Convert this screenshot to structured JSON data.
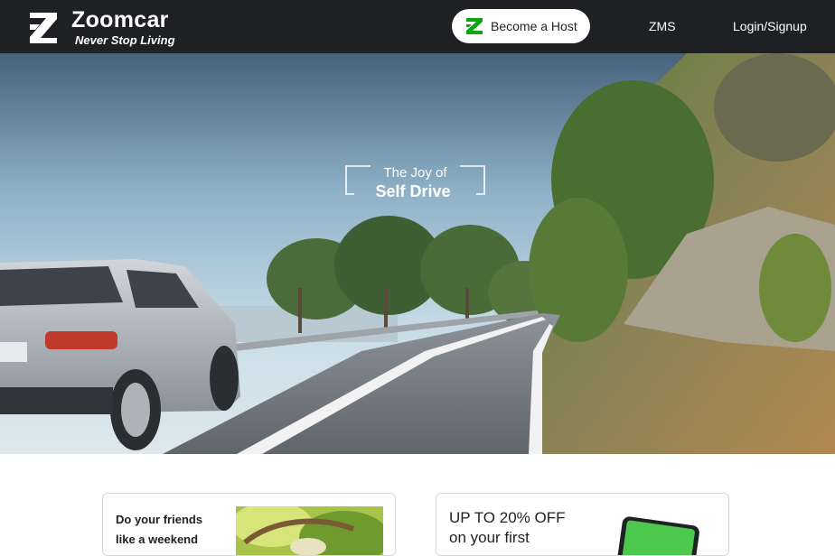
{
  "header": {
    "brand_name": "Zoomcar",
    "brand_tagline": "Never Stop Living",
    "host_button_label": "Become a Host",
    "host_icon": "zoomcar-z-icon",
    "nav": [
      {
        "label": "ZMS"
      },
      {
        "label": "Login/Signup"
      }
    ],
    "colors": {
      "header_bg": "#1e2024",
      "brand_green": "#10a310"
    }
  },
  "hero": {
    "tagline_line1": "The Joy of",
    "tagline_line2": "Self Drive"
  },
  "cards": [
    {
      "text_line1": "Do your friends",
      "text_line2": "like a weekend"
    },
    {
      "text_line1": "UP TO 20% OFF",
      "text_line2": "on your first"
    }
  ]
}
